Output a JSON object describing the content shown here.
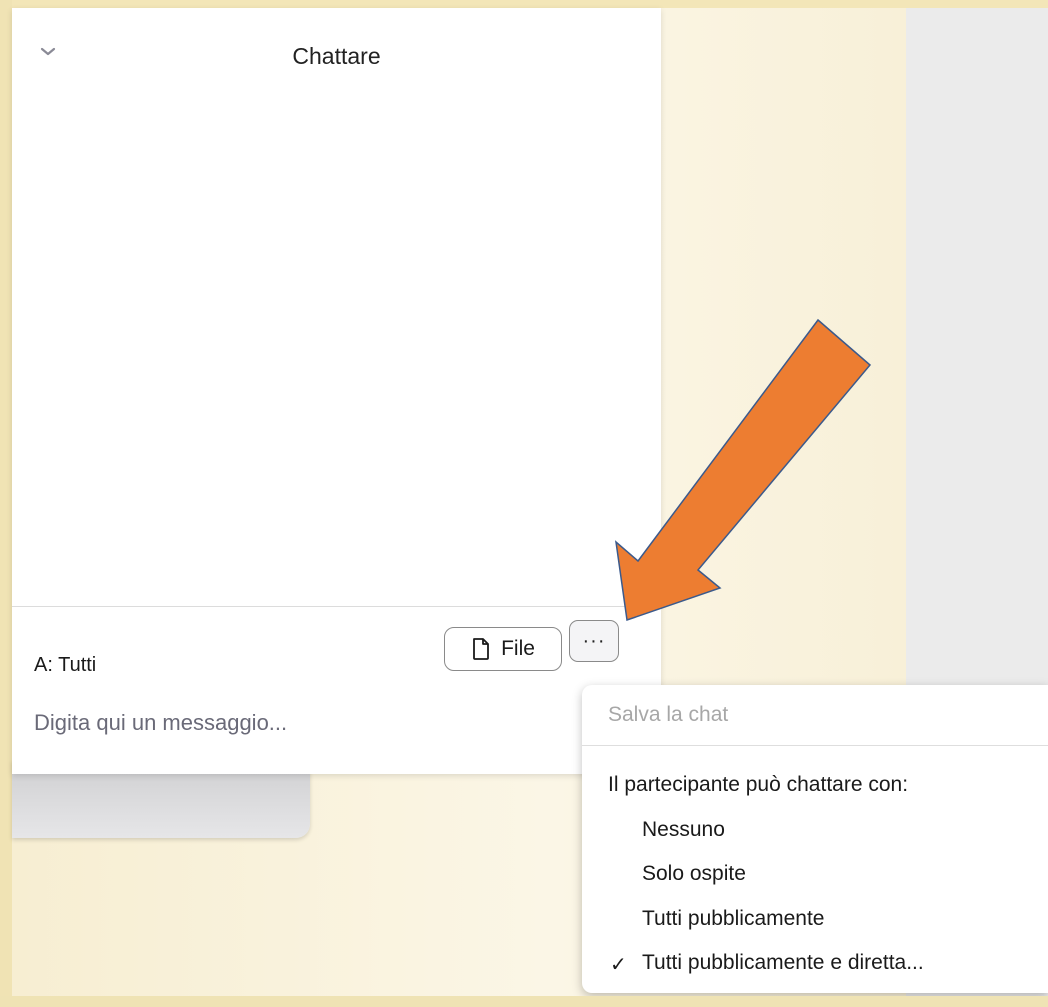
{
  "chat": {
    "title": "Chattare",
    "to_label": "A: Tutti",
    "file_button": "File",
    "more_button": "···",
    "message_placeholder": "Digita qui un messaggio..."
  },
  "menu": {
    "save_chat": "Salva la chat",
    "section_header": "Il partecipante può chattare con:",
    "options": [
      {
        "label": "Nessuno",
        "checked": false
      },
      {
        "label": "Solo ospite",
        "checked": false
      },
      {
        "label": "Tutti pubblicamente",
        "checked": false
      },
      {
        "label": "Tutti pubblicamente e diretta...",
        "checked": true
      }
    ],
    "check_mark": "✓"
  },
  "colors": {
    "arrow_fill": "#ed7d31",
    "arrow_stroke": "#3b5a8c",
    "background_cream": "#f7eed2",
    "panel": "#ffffff"
  }
}
